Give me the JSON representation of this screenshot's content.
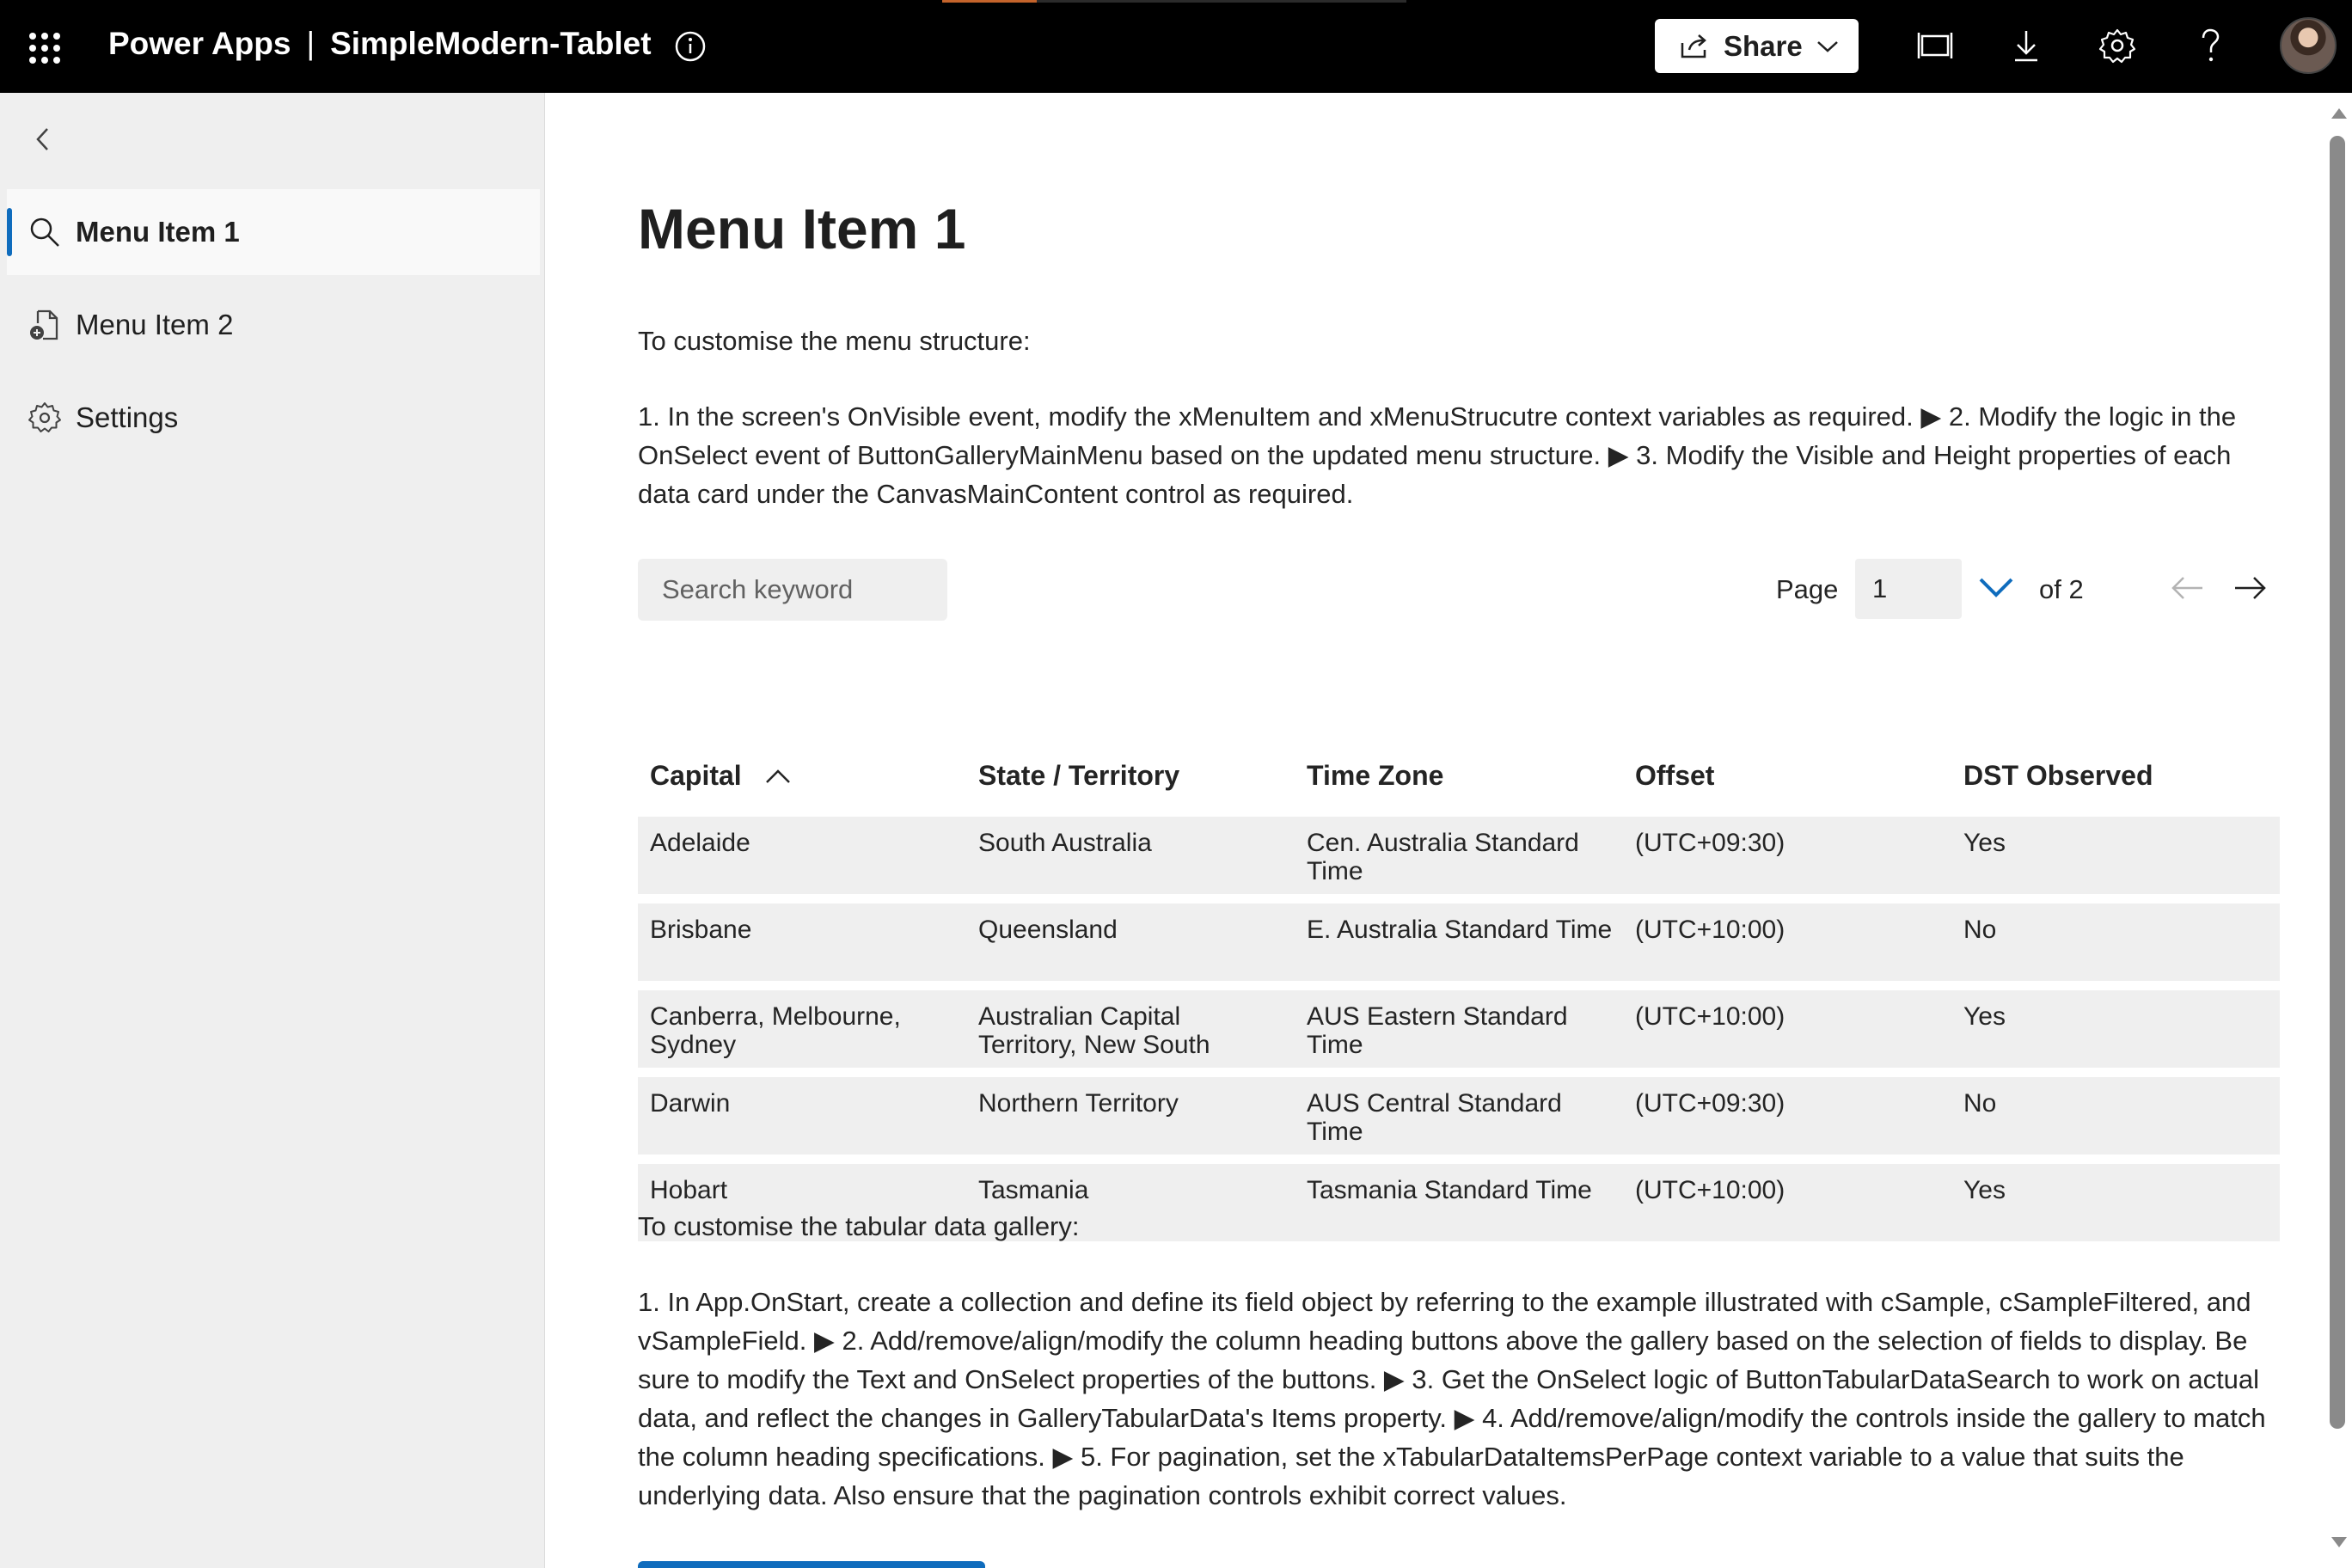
{
  "topbar": {
    "brand": "Power Apps",
    "separator": "|",
    "app_name": "SimpleModern-Tablet",
    "share_label": "Share",
    "icons": [
      "waffle-icon",
      "info-icon",
      "share-icon",
      "chevron-down-icon",
      "fit-to-window-icon",
      "download-icon",
      "gear-icon",
      "help-icon"
    ]
  },
  "sidebar": {
    "items": [
      {
        "label": "Menu Item 1",
        "icon": "search-icon",
        "active": true
      },
      {
        "label": "Menu Item 2",
        "icon": "document-add-icon",
        "active": false
      },
      {
        "label": "Settings",
        "icon": "gear-icon",
        "active": false
      }
    ]
  },
  "main": {
    "title": "Menu Item 1",
    "intro_heading": "To customise the menu structure:",
    "intro_steps": "1. In the screen's OnVisible event, modify the xMenuItem and xMenuStrucutre context variables as required. ▶ 2. Modify the logic in the OnSelect event of ButtonGalleryMainMenu based on the updated menu structure. ▶ 3. Modify the Visible and Height properties of each data card under the CanvasMainContent control as required.",
    "search_placeholder": "Search keyword",
    "pager": {
      "label": "Page",
      "value": "1",
      "of_text": "of 2"
    },
    "table": {
      "headers": [
        "Capital",
        "State / Territory",
        "Time Zone",
        "Offset",
        "DST Observed"
      ],
      "sorted_column": "Capital",
      "rows": [
        [
          "Adelaide",
          "South Australia",
          "Cen. Australia Standard Time",
          "(UTC+09:30)",
          "Yes"
        ],
        [
          "Brisbane",
          "Queensland",
          "E. Australia Standard Time",
          "(UTC+10:00)",
          "No"
        ],
        [
          "Canberra, Melbourne, Sydney",
          "Australian Capital Territory, New South",
          "AUS Eastern Standard Time",
          "(UTC+10:00)",
          "Yes"
        ],
        [
          "Darwin",
          "Northern Territory",
          "AUS Central Standard Time",
          "(UTC+09:30)",
          "No"
        ],
        [
          "Hobart",
          "Tasmania",
          "Tasmania Standard Time",
          "(UTC+10:00)",
          "Yes"
        ]
      ]
    },
    "gallery_heading": "To customise the tabular data gallery:",
    "gallery_steps": "1. In App.OnStart, create a collection and define its field object by referring to the example illustrated with cSample, cSampleFiltered, and vSampleField. ▶ 2. Add/remove/align/modify the column heading buttons above the gallery based on the selection of fields to display. Be sure to modify the Text and OnSelect properties of the buttons. ▶ 3. Get the OnSelect logic of ButtonTabularDataSearch to work on actual data, and reflect the changes in GalleryTabularData's Items property. ▶ 4. Add/remove/align/modify the controls inside the gallery to match the column heading specifications. ▶ 5. For pagination, set the xTabularDataItemsPerPage context variable to a value that suits the underlying data. Also ensure that the pagination controls exhibit correct values."
  },
  "colors": {
    "topbar": "#000000",
    "accent": "#0f6cbd",
    "sidebar_bg": "#efefef",
    "row_bg": "#efefef"
  }
}
